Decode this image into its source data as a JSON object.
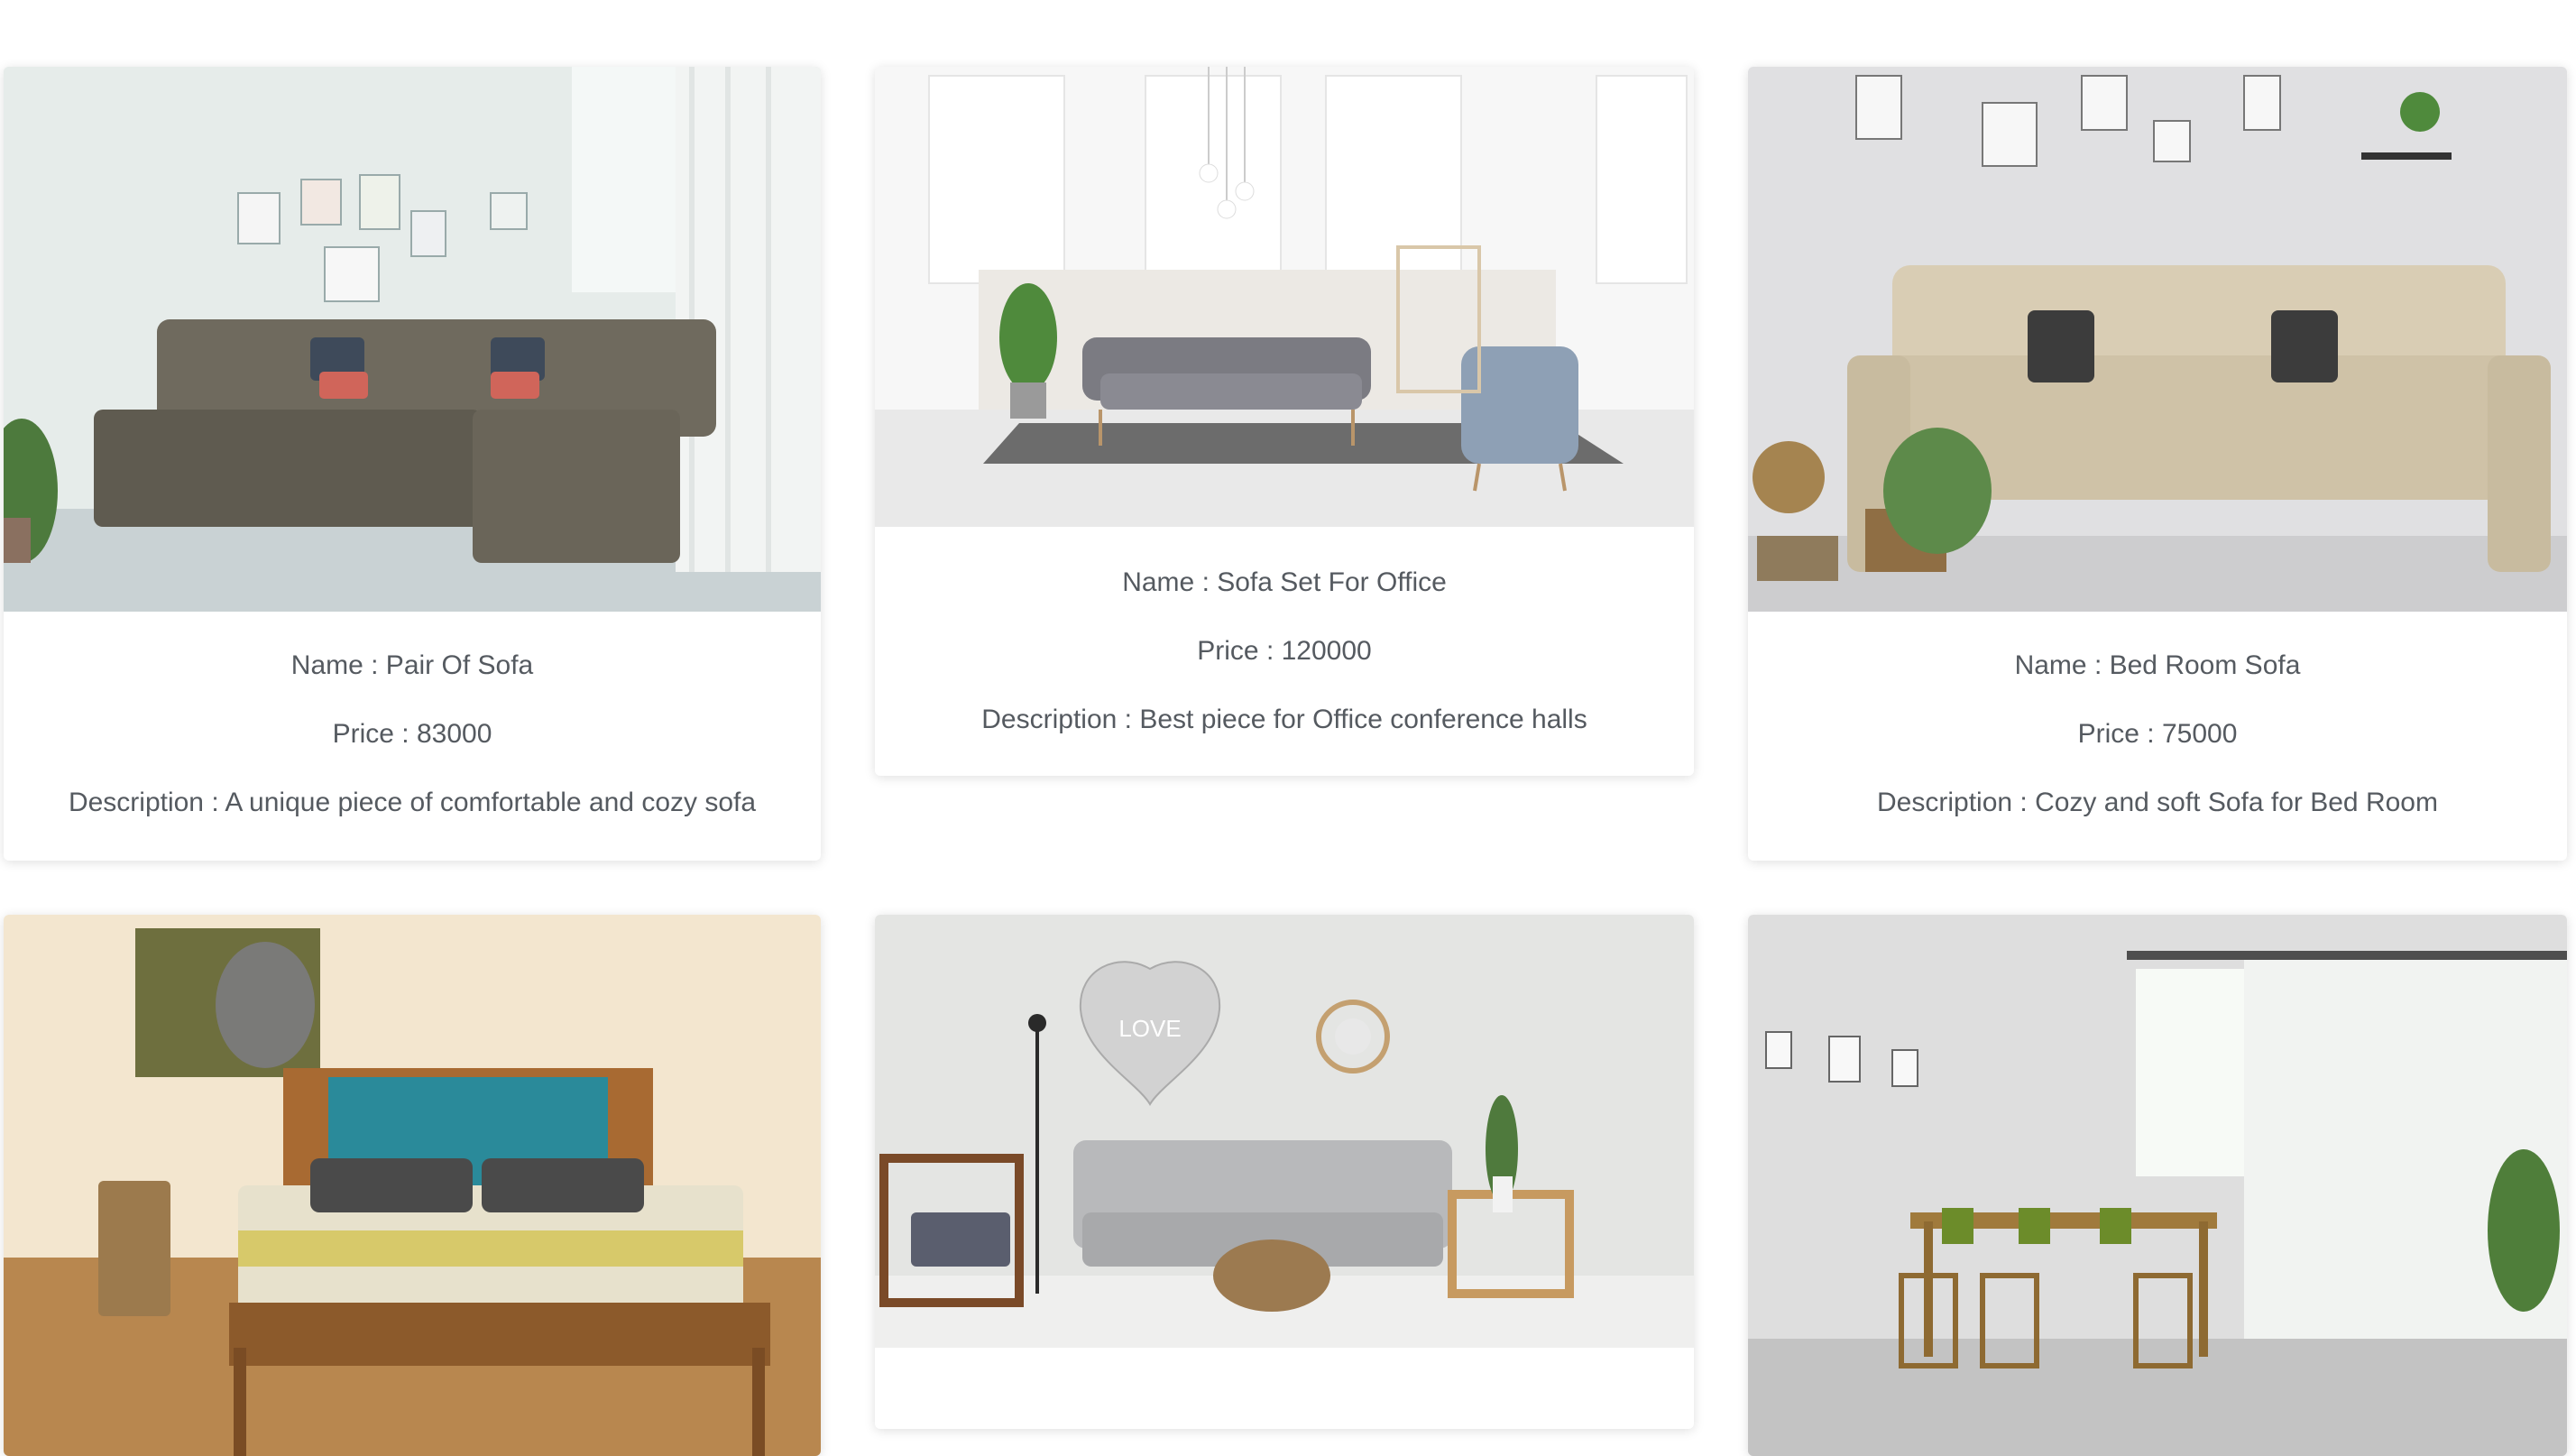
{
  "products": [
    {
      "name": "Name : Pair Of Sofa",
      "price": "Price : 83000",
      "description": "Description : A unique piece of comfortable and cozy sofa"
    },
    {
      "name": "Name : Sofa Set For Office",
      "price": "Price : 120000",
      "description": "Description : Best piece for Office conference halls"
    },
    {
      "name": "Name : Bed Room Sofa",
      "price": "Price : 75000",
      "description": "Description : Cozy and soft Sofa for Bed Room"
    }
  ],
  "wall_art": {
    "love": "LOVE"
  },
  "photos": {
    "pair_of_sofa": "grey sectional sofa",
    "office_sofa": "grey office sofa",
    "bedroom_sofa": "beige sofa",
    "bed": "wooden bed",
    "living_room": "living room",
    "dining": "dining set"
  }
}
